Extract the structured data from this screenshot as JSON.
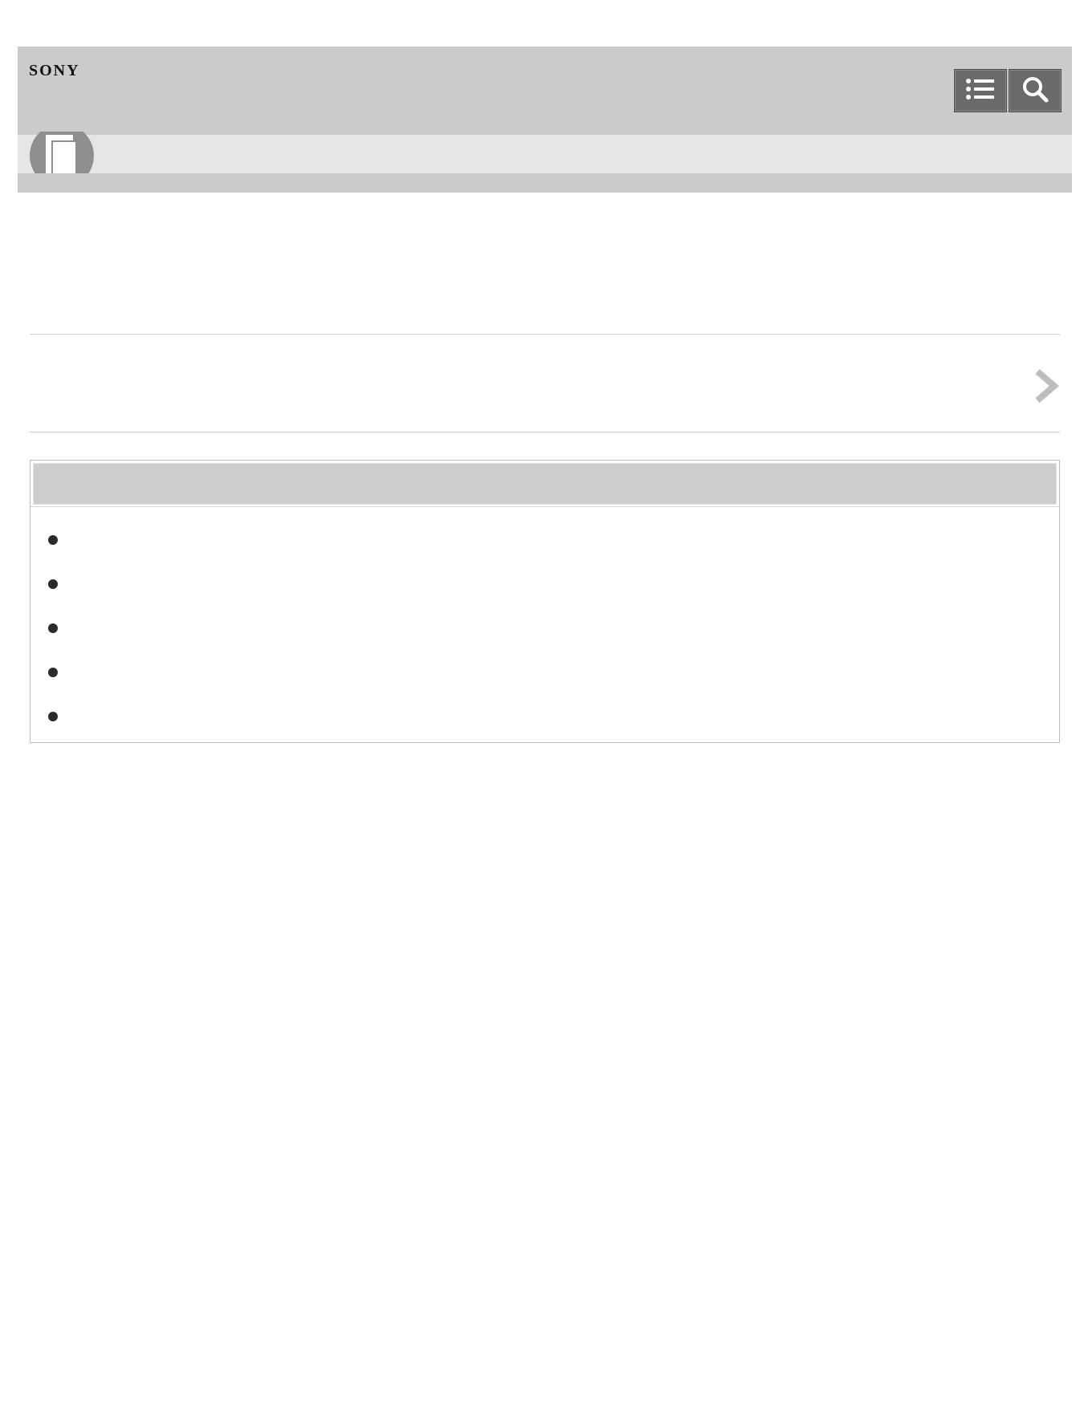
{
  "header": {
    "logo": "SONY",
    "buttons": [
      {
        "name": "contents-list-button",
        "icon": "list-icon"
      },
      {
        "name": "search-button",
        "icon": "search-icon"
      }
    ],
    "manual_icon": "help-guide-book-icon"
  },
  "title": "",
  "nav": {
    "label": "",
    "icon": "chevron-right-icon"
  },
  "contents_box": {
    "heading": "",
    "items": [
      "",
      "",
      "",
      "",
      ""
    ]
  },
  "colors": {
    "header_bg": "#cbcbcb",
    "subbar_bg": "#e6e6e6",
    "button_bg": "#6a6a6a",
    "chevron": "#bdbdbd",
    "box_head_bg": "#cdcdcd"
  }
}
